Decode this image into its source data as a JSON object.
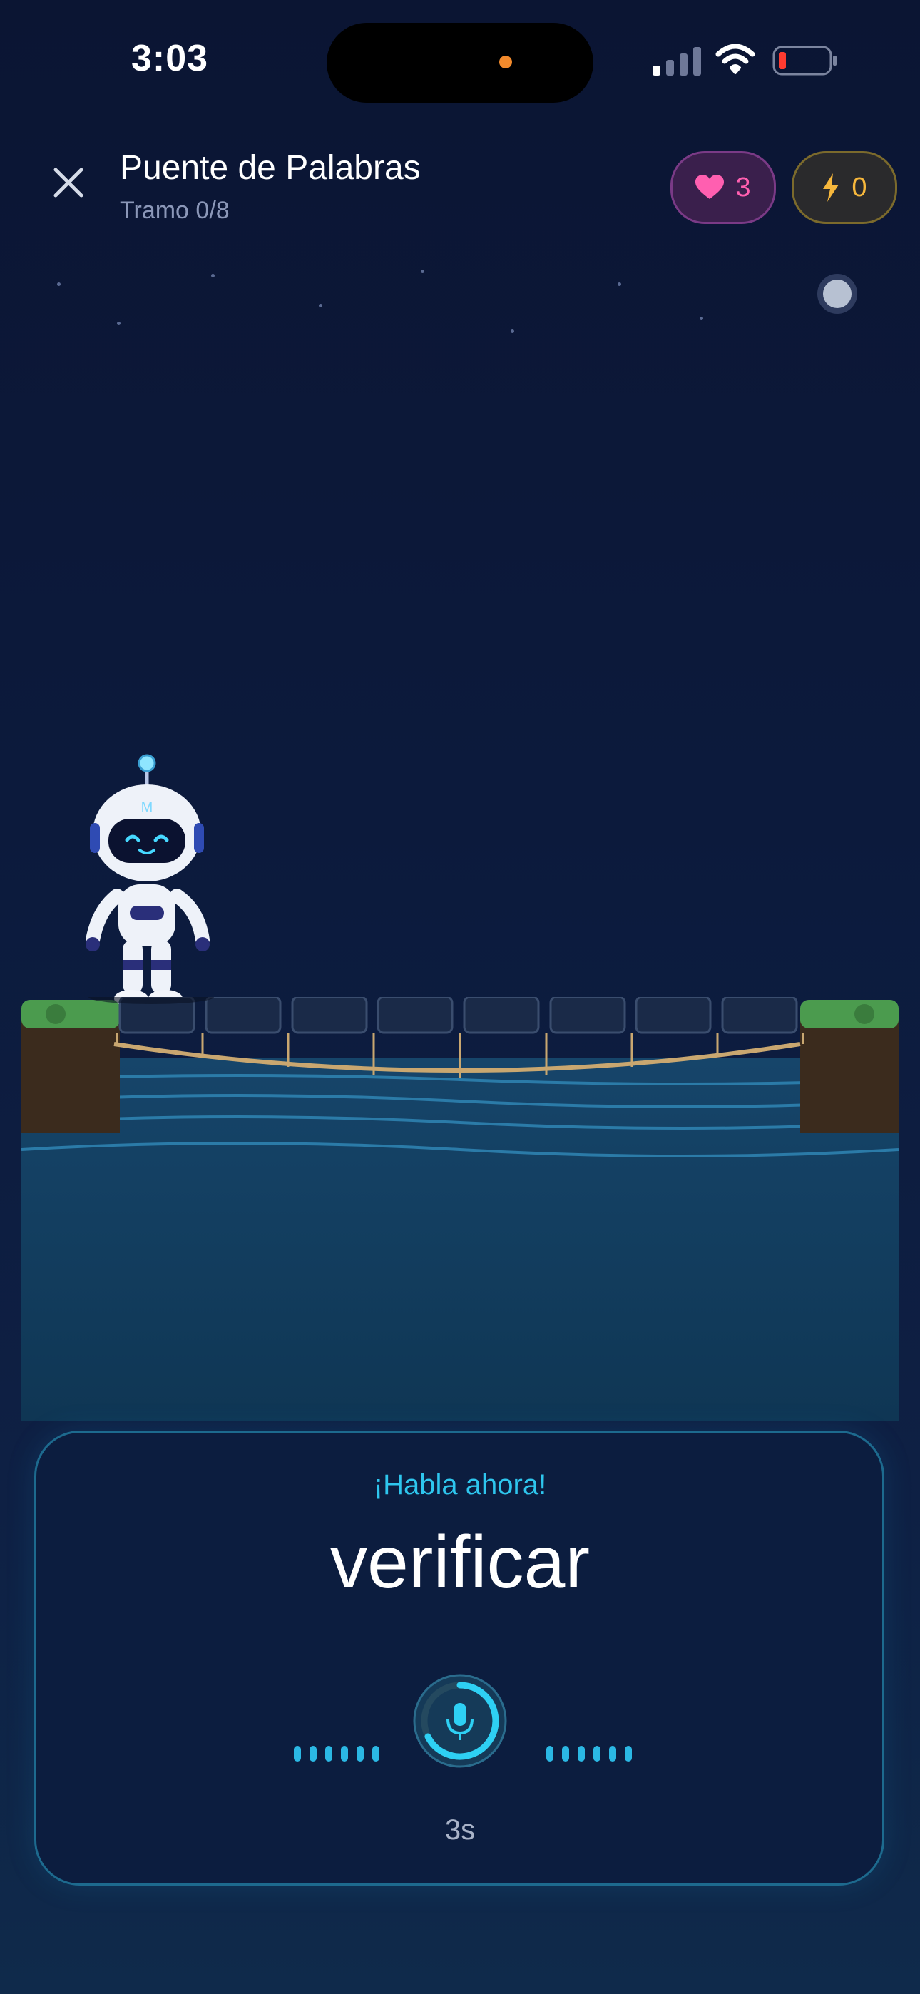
{
  "status_bar": {
    "time": "3:03"
  },
  "header": {
    "title": "Puente de Palabras",
    "subtitle": "Tramo 0/8",
    "hearts": "3",
    "energy": "0"
  },
  "speech_card": {
    "prompt": "¡Habla ahora!",
    "word": "verificar",
    "timer": "3s"
  },
  "bridge": {
    "planks_total": 8,
    "planks_done": 0
  },
  "icons": [
    "close-icon",
    "heart-icon",
    "bolt-icon",
    "microphone-icon",
    "robot-character",
    "moon-icon",
    "signal-icon",
    "wifi-icon",
    "battery-icon"
  ],
  "colors": {
    "accent": "#2ec6ee",
    "hearts": "#ff5fb0",
    "energy": "#f6b73c",
    "background": "#0b1533"
  }
}
